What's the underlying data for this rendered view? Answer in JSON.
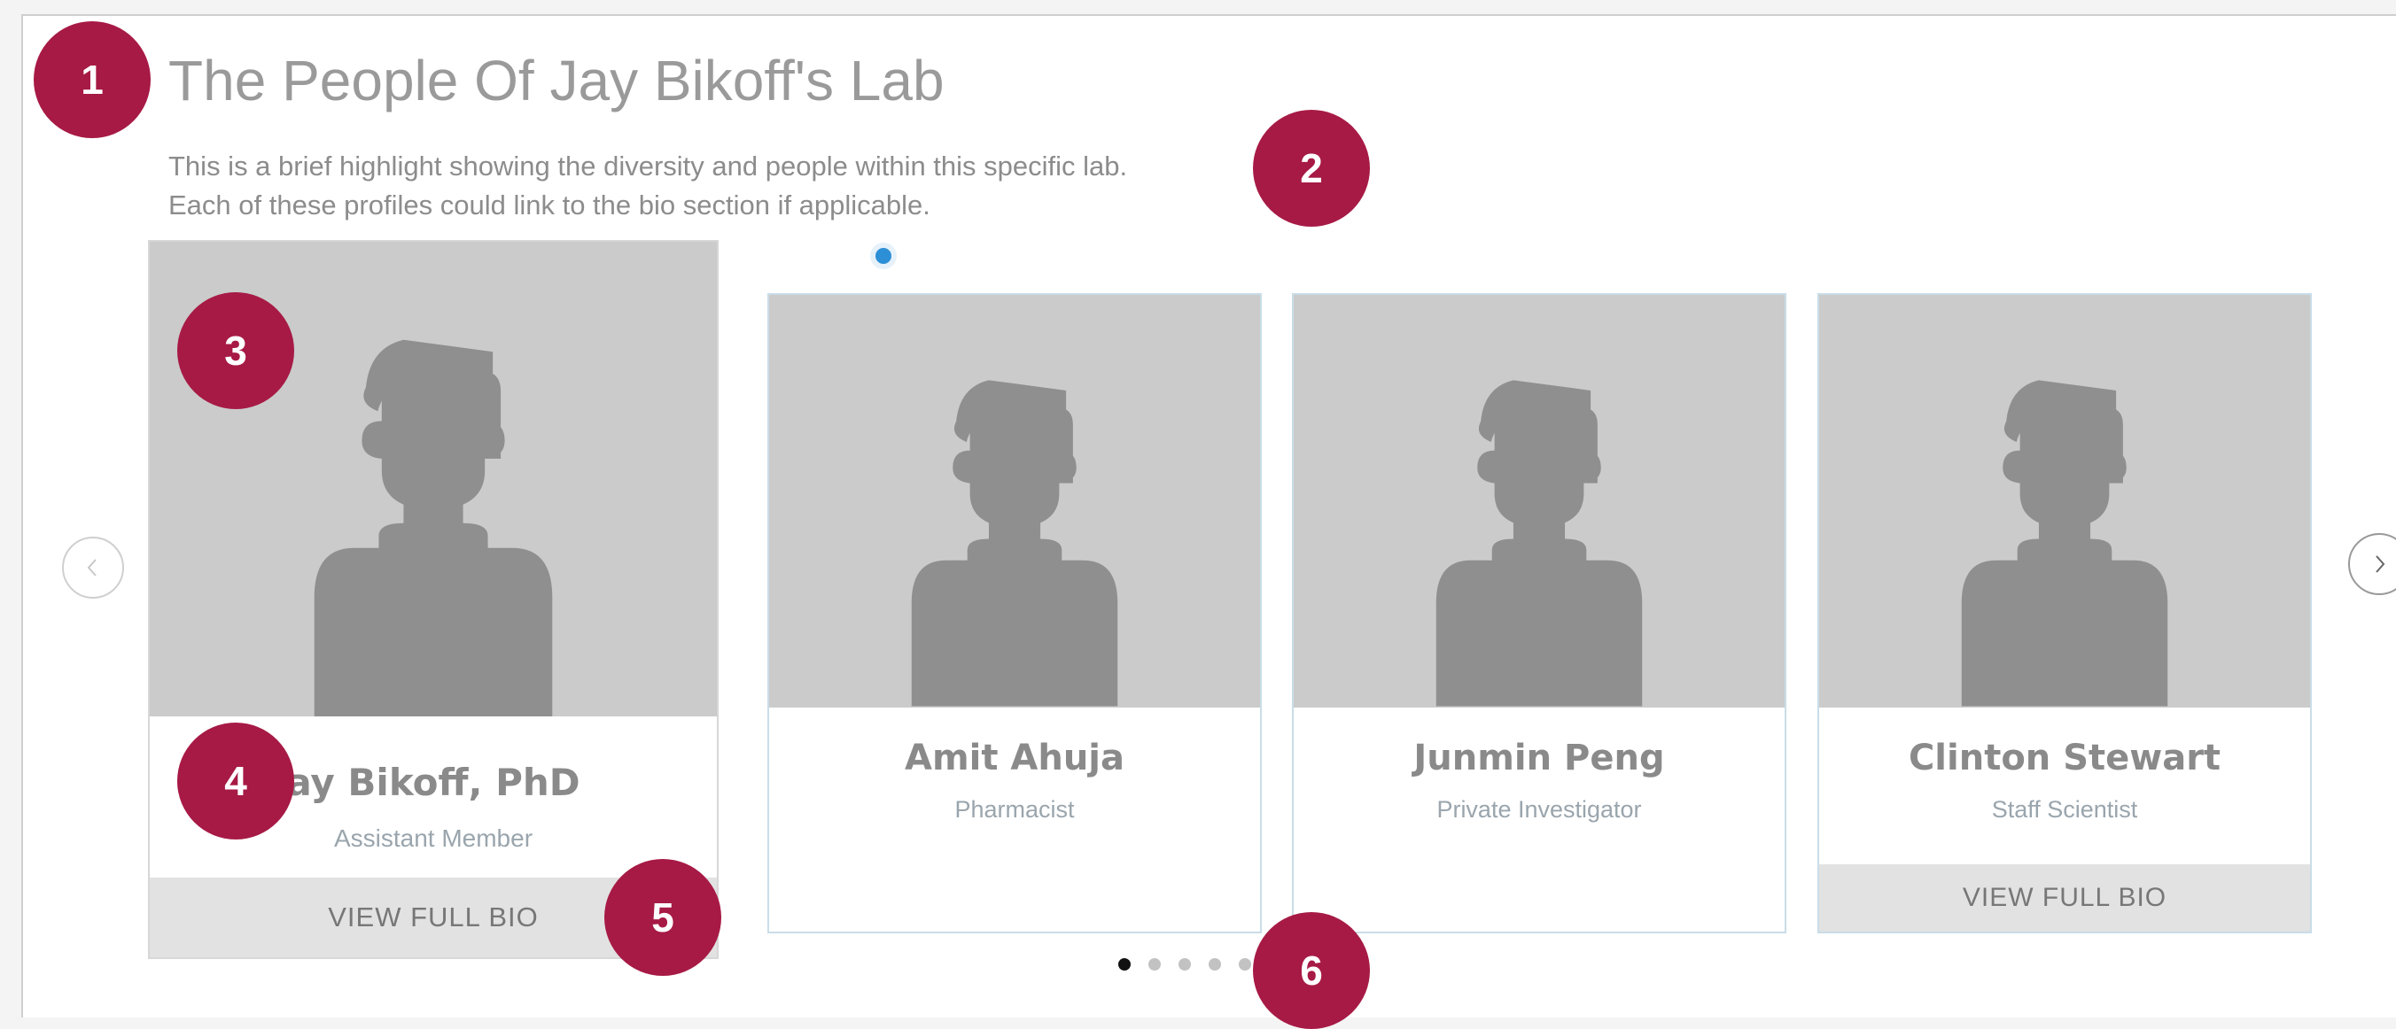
{
  "header": {
    "title": "The People Of Jay Bikoff's Lab",
    "description_line1": "This is a brief highlight showing the diversity and people within this specific lab.",
    "description_line2": "Each of these profiles could link to the bio section if applicable."
  },
  "annotations": [
    "1",
    "2",
    "3",
    "4",
    "5",
    "6"
  ],
  "carousel": {
    "prev_icon": "chevron-left-icon",
    "next_icon": "chevron-right-icon",
    "page_count": 5,
    "active_page": 1,
    "profiles": [
      {
        "name": "ay Bikoff, PhD",
        "role": "Assistant Member",
        "button": "VIEW FULL BIO",
        "featured": true
      },
      {
        "name": "Amit Ahuja",
        "role": "Pharmacist"
      },
      {
        "name": "Junmin Peng",
        "role": "Private Investigator"
      },
      {
        "name": "Clinton Stewart",
        "role": "Staff Scientist",
        "button": "VIEW FULL BIO"
      }
    ]
  },
  "colors": {
    "badge": "#a71a45",
    "photo_bg": "#cbcbcb",
    "silhouette": "#8f8f8f",
    "active_indicator": "#2d8fd6"
  }
}
